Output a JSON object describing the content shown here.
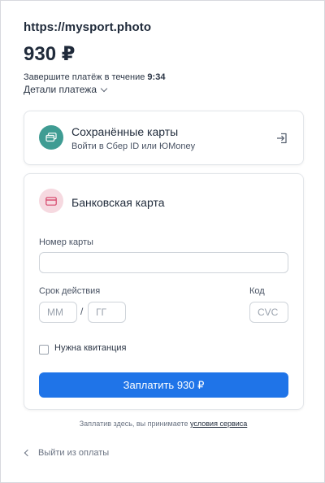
{
  "header": {
    "site": "https://mysport.photo",
    "amount": "930 ₽",
    "timer_prefix": "Завершите платёж в течение",
    "timer_value": "9:34",
    "details_label": "Детали платежа"
  },
  "saved_cards": {
    "title": "Сохранённые карты",
    "subtitle": "Войти в Сбер ID или ЮMoney",
    "icon": "cards-icon",
    "action_icon": "login-arrow-icon"
  },
  "bank_card": {
    "title": "Банковская карта",
    "icon": "credit-card-icon",
    "card_number_label": "Номер карты",
    "card_number_value": "",
    "expiry_label": "Срок действия",
    "month_placeholder": "ММ",
    "slash": "/",
    "year_placeholder": "ГГ",
    "code_label": "Код",
    "cvc_placeholder": "CVC",
    "receipt_label": "Нужна квитанция",
    "pay_label": "Заплатить  930 ₽"
  },
  "footer": {
    "terms_prefix": "Заплатив здесь, вы принимаете",
    "terms_link": "условия сервиса",
    "exit_label": "Выйти из оплаты"
  },
  "colors": {
    "accent": "#1f74e8",
    "saved_icon_bg": "#3f9c93",
    "bank_icon_bg": "#f6d9e0"
  }
}
